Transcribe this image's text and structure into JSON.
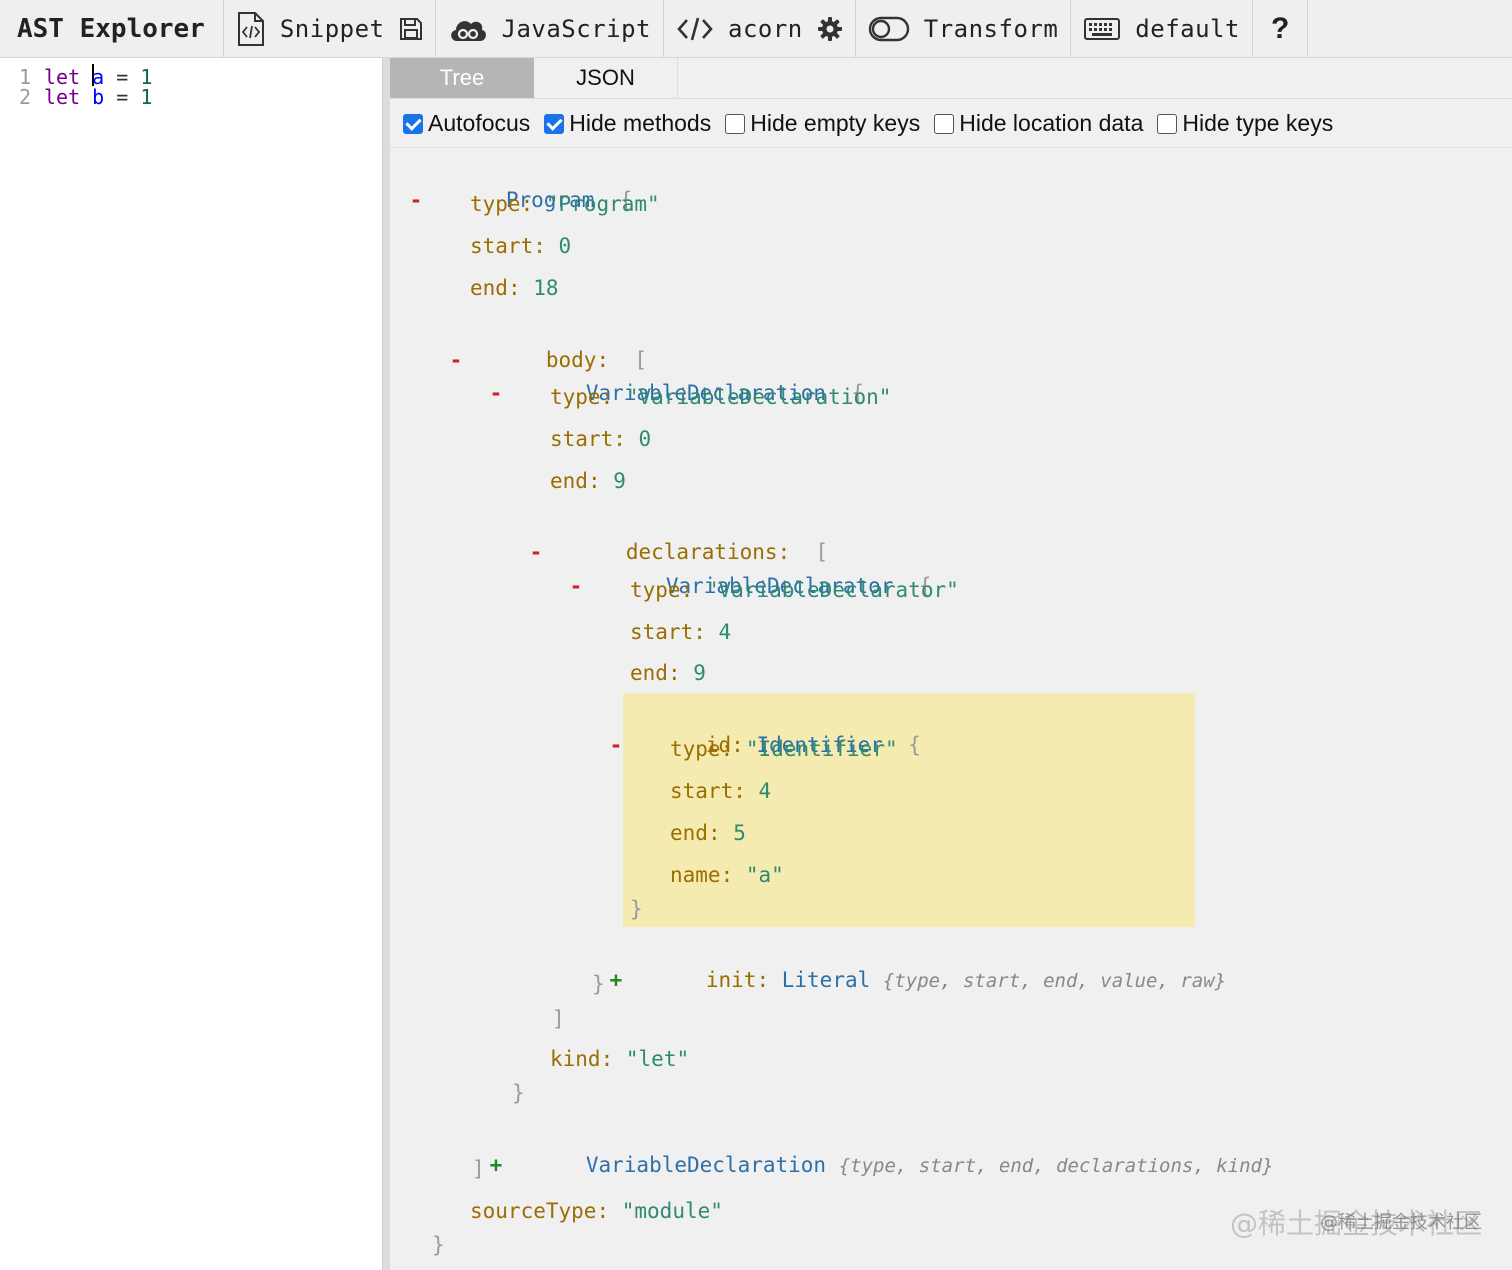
{
  "toolbar": {
    "title": "AST Explorer",
    "snippet_label": "Snippet",
    "language_label": "JavaScript",
    "parser_label": "acorn",
    "transform_label": "Transform",
    "keymap_label": "default",
    "help_label": "?"
  },
  "editor": {
    "lines": [
      {
        "num": "1",
        "kw": "let",
        "var": "a",
        "op": "=",
        "val": "1"
      },
      {
        "num": "2",
        "kw": "let",
        "var": "b",
        "op": "=",
        "val": "1"
      }
    ]
  },
  "tabs": {
    "tree": "Tree",
    "json": "JSON",
    "active": "Tree"
  },
  "options": [
    {
      "label": "Autofocus",
      "checked": true
    },
    {
      "label": "Hide methods",
      "checked": true
    },
    {
      "label": "Hide empty keys",
      "checked": false
    },
    {
      "label": "Hide location data",
      "checked": false
    },
    {
      "label": "Hide type keys",
      "checked": false
    }
  ],
  "tree": {
    "program": {
      "name": "Program",
      "open_brace": "{",
      "type_key": "type",
      "type_val": "\"Program\"",
      "start_key": "start",
      "start_val": "0",
      "end_key": "end",
      "end_val": "18",
      "body_key": "body",
      "body_open": "[",
      "body_close": "]",
      "source_key": "sourceType",
      "source_val": "\"module\"",
      "close": "}"
    },
    "decl1": {
      "name": "VariableDeclaration",
      "open_brace": "{",
      "type_key": "type",
      "type_val": "\"VariableDeclaration\"",
      "start_key": "start",
      "start_val": "0",
      "end_key": "end",
      "end_val": "9",
      "decls_key": "declarations",
      "decls_open": "[",
      "decls_close": "]",
      "kind_key": "kind",
      "kind_val": "\"let\"",
      "close": "}"
    },
    "declarator": {
      "name": "VariableDeclarator",
      "open_brace": "{",
      "type_key": "type",
      "type_val": "\"VariableDeclarator\"",
      "start_key": "start",
      "start_val": "4",
      "end_key": "end",
      "end_val": "9",
      "close": "}"
    },
    "id": {
      "key": "id",
      "name": "Identifier",
      "open_brace": "{",
      "type_key": "type",
      "type_val": "\"Identifier\"",
      "start_key": "start",
      "start_val": "4",
      "end_key": "end",
      "end_val": "5",
      "name_key": "name",
      "name_val": "\"a\"",
      "close": "}"
    },
    "init": {
      "key": "init",
      "name": "Literal",
      "summary": "{type, start, end, value, raw}"
    },
    "decl2": {
      "name": "VariableDeclaration",
      "summary": "{type, start, end, declarations, kind}"
    },
    "colon": ":",
    "minus": "-",
    "plus": "+"
  },
  "watermark": {
    "main": "@稀土掘金技术社区",
    "small": "@稀土掘金技术社区"
  }
}
